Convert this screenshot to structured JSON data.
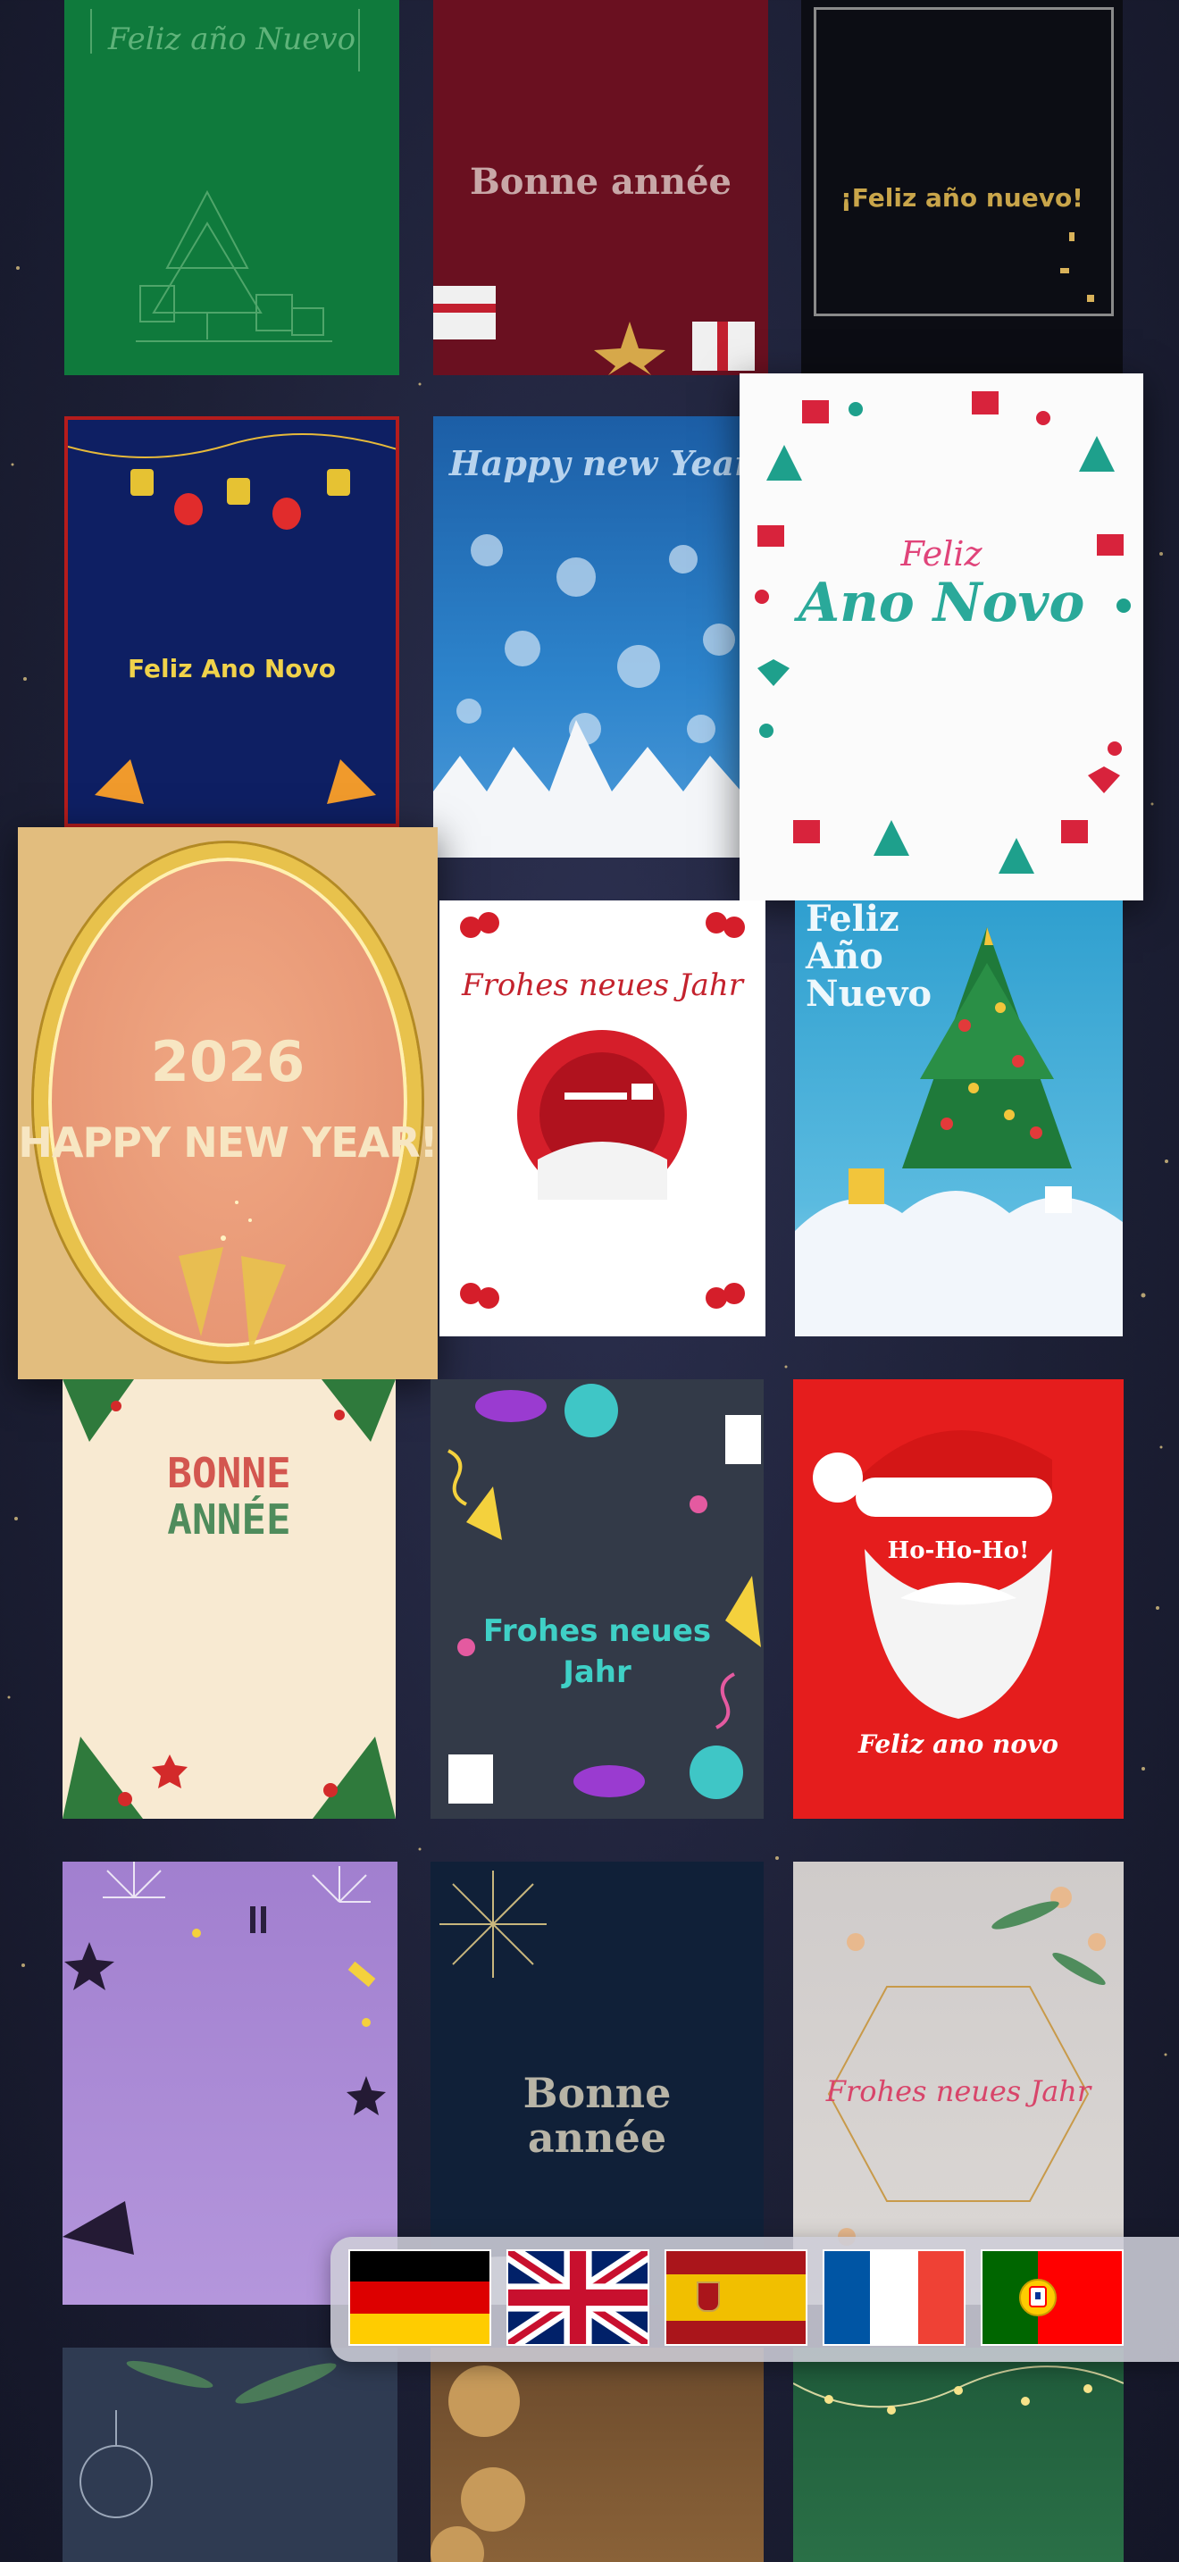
{
  "cards": {
    "feliz_ano_nuevo_green": "Feliz año Nuevo",
    "bonne_annee_red": "Bonne année",
    "feliz_ano_nuevo_black": "¡Feliz año nuevo!",
    "feliz_ano_novo_lanterns": "Feliz Ano Novo",
    "happy_new_year_snow": "Happy new Year",
    "feliz_ano_novo_featured": {
      "line1": "Feliz",
      "line2": "Ano Novo"
    },
    "happy_new_year_gold": {
      "year": "2026",
      "text": "HAPPY NEW YEAR!"
    },
    "frohes_neues_jahr_sleigh": "Frohes neues Jahr",
    "feliz_ano_nuevo_tree": {
      "line1": "Feliz",
      "line2": "Año",
      "line3": "Nuevo"
    },
    "bonne_annee_cream": {
      "line1": "BONNE",
      "line2": "ANNÉE"
    },
    "frohes_neues_jahr_party": {
      "line1": "Frohes neues",
      "line2": "Jahr"
    },
    "santa_hohoho": {
      "bubble": "Ho-Ho-Ho!",
      "text": "Feliz ano novo"
    },
    "bonne_annee_night": {
      "line1": "Bonne",
      "line2": "année"
    },
    "frohes_neues_jahr_hexagon": "Frohes neues Jahr"
  },
  "languages": [
    "German",
    "English",
    "Spanish",
    "French",
    "Portuguese"
  ],
  "colors": {
    "background": "#1d2036",
    "gold": "#e8c25a",
    "accent_red": "#d8232a",
    "teal": "#2fb59e"
  },
  "icons": [
    "german-flag-icon",
    "uk-flag-icon",
    "spanish-flag-icon",
    "french-flag-icon",
    "portuguese-flag-icon"
  ]
}
